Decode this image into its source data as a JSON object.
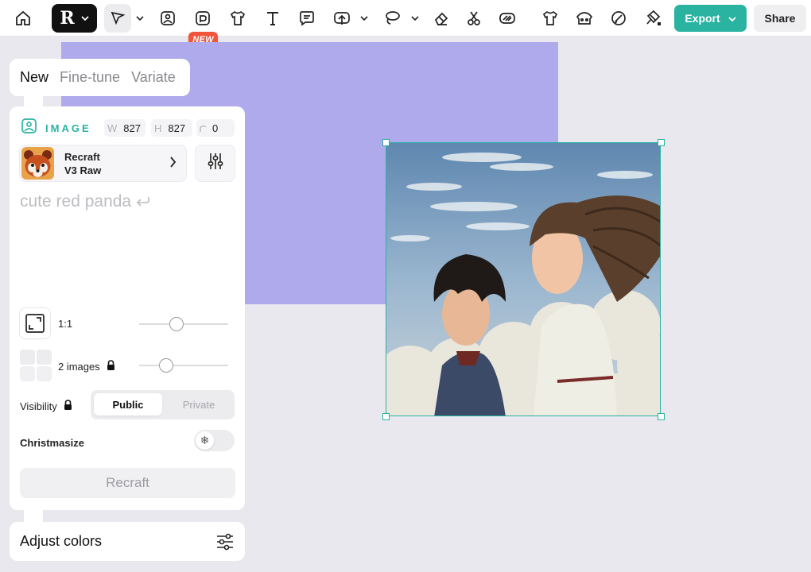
{
  "toolbar": {
    "new_badge": "NEW",
    "export_label": "Export",
    "share_label": "Share",
    "icons": [
      "home-icon",
      "logo-icon",
      "select-tool-icon",
      "image-tool-icon",
      "image-new-tool-icon",
      "mockup-shirt-icon",
      "text-tool-icon",
      "comment-icon",
      "upload-icon",
      "lasso-icon",
      "eraser-icon",
      "scissors-icon",
      "vectorize-icon",
      "tshirt-icon",
      "group-icon",
      "brush-icon",
      "magic-tool-icon"
    ]
  },
  "panel_tabs": [
    "New",
    "Fine-tune",
    "Variate"
  ],
  "panel": {
    "section_label": "IMAGE",
    "width_key": "W",
    "width_value": "827",
    "height_key": "H",
    "height_value": "827",
    "corner_value": "0",
    "model_line1": "Recraft",
    "model_line2": "V3 Raw",
    "prompt_placeholder": "cute red panda",
    "aspect_label": "1:1",
    "aspect_slider": 0.42,
    "images_label": "2 images",
    "images_slider": 0.3,
    "visibility_label": "Visibility",
    "visibility_public": "Public",
    "visibility_private": "Private",
    "christmasize_label": "Christmasize",
    "recraft_button": "Recraft"
  },
  "adjust_colors_label": "Adjust colors",
  "colors": {
    "accent": "#2ab3a1",
    "frame": "#aeaaec",
    "badge": "#f0553b"
  }
}
